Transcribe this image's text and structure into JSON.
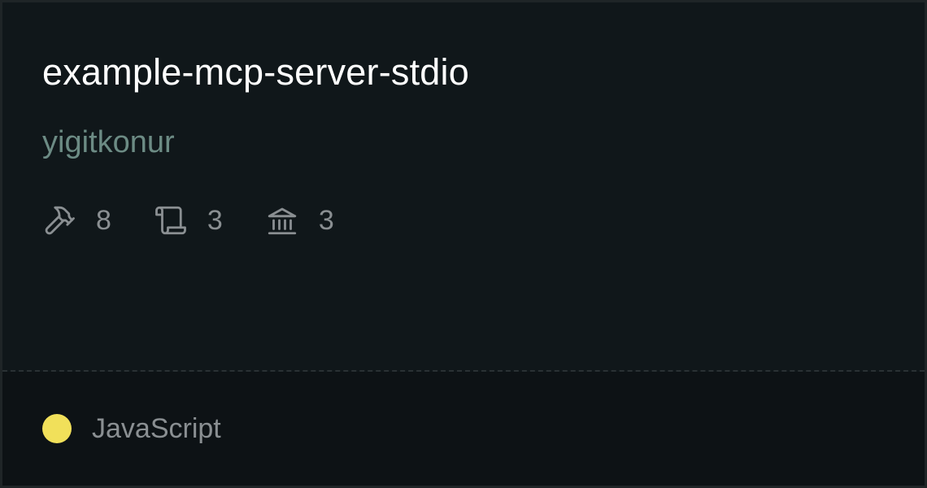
{
  "card": {
    "title": "example-mcp-server-stdio",
    "author": "yigitkonur",
    "stats": [
      {
        "icon": "hammer-icon",
        "count": "8"
      },
      {
        "icon": "scroll-icon",
        "count": "3"
      },
      {
        "icon": "bank-icon",
        "count": "3"
      }
    ],
    "language": {
      "name": "JavaScript",
      "color": "#f1e05a"
    }
  }
}
